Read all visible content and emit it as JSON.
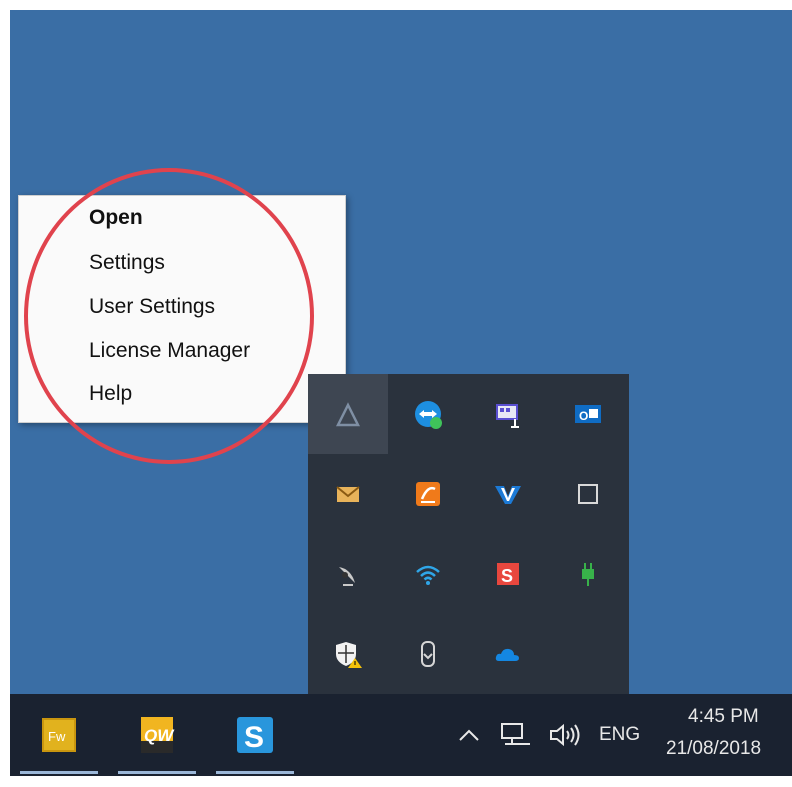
{
  "context_menu": {
    "items": [
      {
        "label": "Open",
        "bold": true
      },
      {
        "label": "Settings"
      },
      {
        "label": "User Settings"
      },
      {
        "label": "License Manager"
      },
      {
        "label": "Help"
      }
    ]
  },
  "tray_overflow": {
    "icons": [
      "app-triangle-icon",
      "teamviewer-icon",
      "projector-icon",
      "outlook-icon",
      "mail-envelope-icon",
      "orange-app-icon",
      "v-app-icon",
      "square-app-icon",
      "satellite-dish-icon",
      "wifi-icon",
      "red-s-app-icon",
      "power-plug-icon",
      "security-shield-icon",
      "usb-drive-icon",
      "onedrive-cloud-icon"
    ]
  },
  "taskbar": {
    "apps": [
      {
        "name": "fireworks-app",
        "label": "Fw"
      },
      {
        "name": "quickwrite-app",
        "label": "QW"
      },
      {
        "name": "s-app",
        "label": "S"
      }
    ],
    "language": "ENG",
    "time": "4:45 PM",
    "date": "21/08/2018"
  },
  "colors": {
    "desktop": "#3a6ea5",
    "taskbar": "#1a2230",
    "annotation": "#e0434d"
  }
}
